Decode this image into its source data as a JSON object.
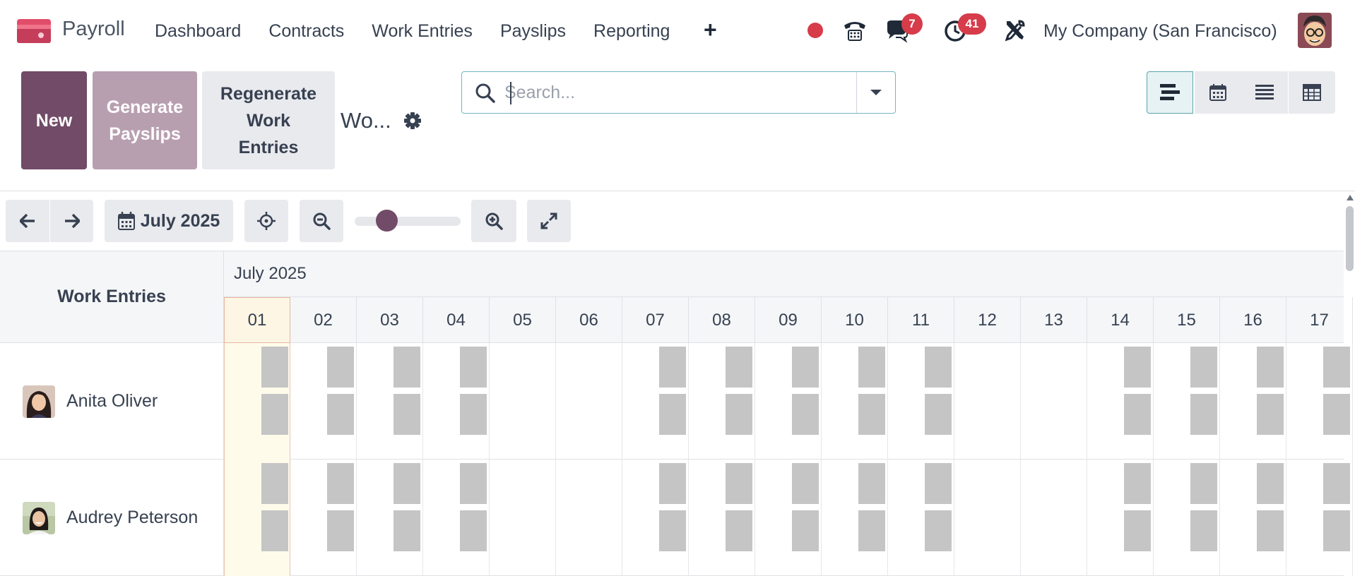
{
  "navbar": {
    "app_name": "Payroll",
    "menu": [
      "Dashboard",
      "Contracts",
      "Work Entries",
      "Payslips",
      "Reporting"
    ],
    "plus": "+",
    "chat_badge": "7",
    "activity_badge": "41",
    "company": "My Company (San Francisco)"
  },
  "control_panel": {
    "new_label": "New",
    "generate_label": "Generate Payslips",
    "regenerate_label": "Regenerate Work Entries",
    "breadcrumb": "Wo...",
    "search_placeholder": "Search..."
  },
  "gantt": {
    "period_label": "July 2025",
    "slider_fraction": 0.3,
    "row_header": "Work Entries",
    "month": "July 2025",
    "days": [
      "01",
      "02",
      "03",
      "04",
      "05",
      "06",
      "07",
      "08",
      "09",
      "10",
      "11",
      "12",
      "13",
      "14",
      "15",
      "16",
      "17"
    ],
    "today_index": 0,
    "working_day_indices": [
      0,
      1,
      2,
      3,
      6,
      7,
      8,
      9,
      10,
      13,
      14,
      15,
      16
    ],
    "rows": [
      {
        "name": "Anita Oliver"
      },
      {
        "name": "Audrey Peterson"
      }
    ]
  },
  "colors": {
    "brand": "#714b67",
    "brand_light": "#b89fb0",
    "badge": "#d63c4a",
    "entry": "#c5c5c5",
    "today": "#fffbeb"
  },
  "icons": [
    "app-logo-icon",
    "phone-icon",
    "chat-icon",
    "clock-icon",
    "tools-icon",
    "gear-icon",
    "search-icon",
    "chevron-down-icon",
    "gantt-view-icon",
    "calendar-view-icon",
    "list-view-icon",
    "pivot-view-icon",
    "arrow-left-icon",
    "arrow-right-icon",
    "calendar-icon",
    "crosshair-icon",
    "zoom-out-icon",
    "zoom-in-icon",
    "expand-icon"
  ]
}
